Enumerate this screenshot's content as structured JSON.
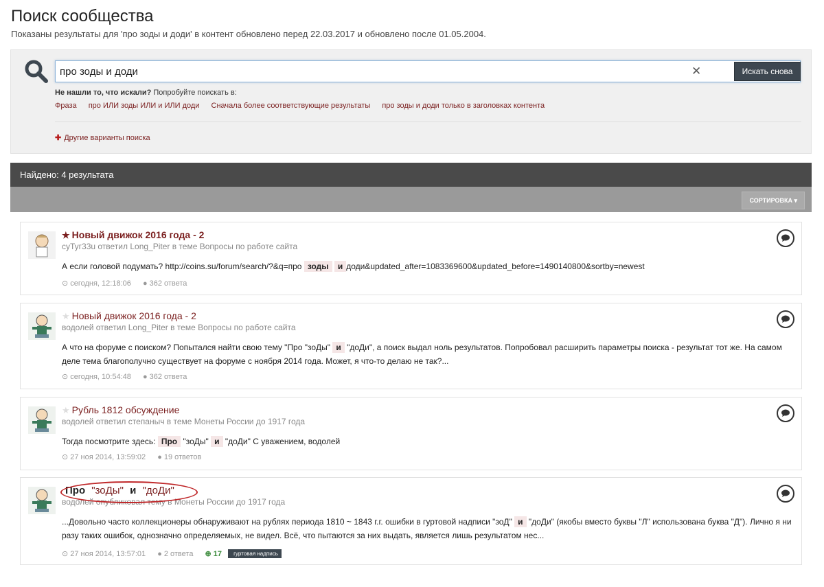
{
  "header": {
    "title": "Поиск сообщества",
    "subtitle": "Показаны результаты для 'про зоды и доди' в контент обновлено перед 22.03.2017 и обновлено после 01.05.2004."
  },
  "search": {
    "value": "про зоды и доди",
    "button": "Искать снова",
    "not_found_bold": "Не нашли то, что искали?",
    "not_found_rest": " Попробуйте поискать в:",
    "suggestions": [
      "Фраза",
      "про ИЛИ зоды ИЛИ и ИЛИ доди",
      "Сначала более соответствующие результаты",
      "про зоды и доди только в заголовках контента"
    ],
    "more_options": "Другие варианты поиска",
    "clear_icon": "close-icon"
  },
  "results_header": "Найдено: 4 результата",
  "sort_label": "СОРТИРОВКА ▾",
  "results": [
    {
      "title": "Новый движок 2016 года - 2",
      "meta": "суТуг33u ответил Long_Piter в теме Вопросы по работе сайта",
      "text_before": "А если головой подумать? http://coins.su/forum/search/?&q=про ",
      "hl1": "зоды",
      "hl2": "и",
      "text_after": "доди&updated_after=1083369600&updated_before=1490140800&sortby=newest",
      "time": "сегодня, 12:18:06",
      "replies": "362 ответа"
    },
    {
      "title": "Новый движок 2016 года - 2",
      "meta": "водолей ответил Long_Piter в теме Вопросы по работе сайта",
      "text_before": "А что на форуме с поиском? Попытался найти свою тему \"Про \"зоДы\" ",
      "hl": "и",
      "text_after": " \"доДи\", а поиск выдал ноль результатов. Попробовал расширить параметры поиска - результат тот же. На самом деле тема благополучно существует на форуме с ноября 2014 года. Может, я что-то делаю не так?...",
      "time": "сегодня, 10:54:48",
      "replies": "362 ответа"
    },
    {
      "title": "Рубль 1812 обсуждение",
      "meta": "водолей ответил степаныч в теме Монеты России до 1917 года",
      "text_before": "Тогда посмотрите здесь: ",
      "hl1": "Про",
      "mid1": "\"зоДы\" ",
      "hl2": "и",
      "text_after": "\"доДи\" С уважением, водолей",
      "time": "27 ноя 2014, 13:59:02",
      "replies": "19 ответов"
    },
    {
      "title_hl1": "Про",
      "title_mid": " \"зоДы\" ",
      "title_hl2": "и",
      "title_end": " \"доДи\"",
      "meta": "водолей опубликовал тему в Монеты России до 1917 года",
      "text_before": "...Довольно часто коллекционеры обнаруживают на рублях периода 1810 ~ 1843 г.г. ошибки в гуртовой надписи \"зоД\" ",
      "hl": "и",
      "text_after": " \"доДи\" (якобы вместо буквы \"Л\" использована буква \"Д\"). Лично я ни разу таких ошибок, однозначно определяемых, не видел. Всё, что пытаются за них выдать, является лишь результатом нес...",
      "time": "27 ноя 2014, 13:57:01",
      "replies": "2 ответа",
      "reputation": "17",
      "tag": "гуртовая надпись"
    }
  ]
}
